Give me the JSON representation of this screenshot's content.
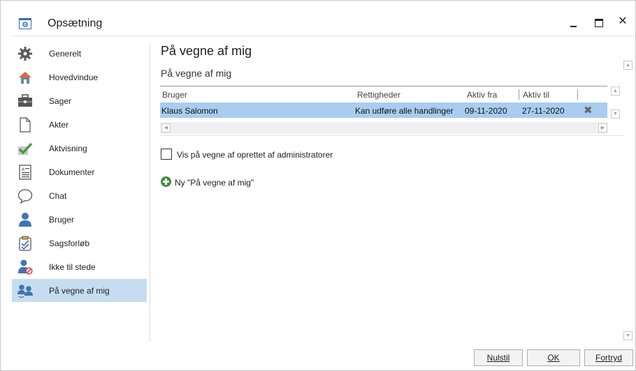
{
  "window": {
    "title": "Opsætning",
    "controls": {
      "minimize": "_",
      "maximize": "□",
      "close": "✕"
    }
  },
  "sidebar": {
    "items": [
      {
        "label": "Generelt",
        "icon": "gear-icon"
      },
      {
        "label": "Hovedvindue",
        "icon": "home-icon"
      },
      {
        "label": "Sager",
        "icon": "briefcase-icon"
      },
      {
        "label": "Akter",
        "icon": "blank-document-icon"
      },
      {
        "label": "Aktvisning",
        "icon": "checkmark-icon"
      },
      {
        "label": "Dokumenter",
        "icon": "document-icon"
      },
      {
        "label": "Chat",
        "icon": "chat-bubble-icon"
      },
      {
        "label": "Bruger",
        "icon": "user-icon"
      },
      {
        "label": "Sagsforløb",
        "icon": "clipboard-check-icon"
      },
      {
        "label": "Ikke til stede",
        "icon": "user-away-icon"
      },
      {
        "label": "På vegne af mig",
        "icon": "users-icon",
        "selected": true
      }
    ]
  },
  "main": {
    "heading": "På vegne af mig",
    "subheading": "På vegne af mig",
    "grid": {
      "columns": [
        "Bruger",
        "Rettigheder",
        "Aktiv fra",
        "Aktiv til"
      ],
      "rows": [
        {
          "bruger": "Klaus Salomon",
          "rettigheder": "Kan udføre alle handlinger",
          "aktiv_fra": "09-11-2020",
          "aktiv_til": "27-11-2020",
          "delete": "✖"
        }
      ]
    },
    "checkbox_label": "Vis på vegne af oprettet af administratorer",
    "checkbox_checked": false,
    "new_link": "Ny \"På vegne af mig\""
  },
  "footer": {
    "reset": "Nulstil",
    "ok": "OK",
    "cancel": "Fortryd"
  },
  "colors": {
    "selection": "#c6dcf1",
    "row_selected": "#a8cdf0",
    "accent": "#2f6fb6"
  }
}
